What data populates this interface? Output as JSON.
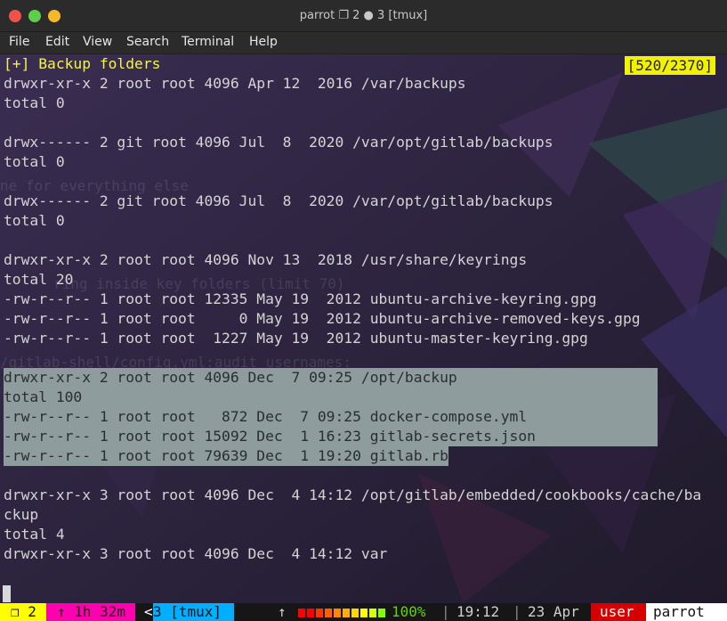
{
  "window": {
    "title": "parrot ❐ 2 ● 3 [tmux]"
  },
  "menu": [
    "File",
    "Edit",
    "View",
    "Search",
    "Terminal",
    "Help"
  ],
  "terminal": {
    "header": "[+] Backup folders",
    "position_indicator": "[520/2370]",
    "lines": [
      "drwxr-xr-x 2 root root 4096 Apr 12  2016 /var/backups",
      "total 0",
      "",
      "drwx------ 2 git root 4096 Jul  8  2020 /var/opt/gitlab/backups",
      "total 0",
      "",
      "drwx------ 2 git root 4096 Jul  8  2020 /var/opt/gitlab/backups",
      "total 0",
      "",
      "drwxr-xr-x 2 root root 4096 Nov 13  2018 /usr/share/keyrings",
      "total 20",
      "-rw-r--r-- 1 root root 12335 May 19  2012 ubuntu-archive-keyring.gpg",
      "-rw-r--r-- 1 root root     0 May 19  2012 ubuntu-archive-removed-keys.gpg",
      "-rw-r--r-- 1 root root  1227 May 19  2012 ubuntu-master-keyring.gpg"
    ],
    "highlighted_lines": [
      "drwxr-xr-x 2 root root 4096 Dec  7 09:25 /opt/backup                       ",
      "total 100                                                                  ",
      "-rw-r--r-- 1 root root   872 Dec  7 09:25 docker-compose.yml               ",
      "-rw-r--r-- 1 root root 15092 Dec  1 16:23 gitlab-secrets.json              ",
      "-rw-r--r-- 1 root root 79639 Dec  1 19:20 gitlab.rb"
    ],
    "lines_after": [
      "",
      "drwxr-xr-x 3 root root 4096 Dec  4 14:12 /opt/gitlab/embedded/cookbooks/cache/ba",
      "ckup",
      "total 4",
      "drwxr-xr-x 3 root root 4096 Dec  4 14:12 var"
    ],
    "ghost_lines": [
      "ne for everything else",
      "ring inside key folders (limit 70)",
      "/gitlab-shell/config.yml:audit_usernames:"
    ]
  },
  "status_bar": {
    "session": "❐ 2",
    "uptime": "↑ 1h 32m",
    "window_prefix": "<",
    "window": "3 [tmux]",
    "battery_arrow": "↑",
    "battery_percent": "100%",
    "battery_level": 1.0,
    "time": "19:12",
    "date": "23 Apr",
    "user": "user",
    "host": "parrot",
    "colors": {
      "session_bg": "#ffff00",
      "uptime_bg": "#ff00af",
      "window_bg": "#00afff",
      "user_bg": "#d70000",
      "host_bg": "#ffffff"
    }
  }
}
